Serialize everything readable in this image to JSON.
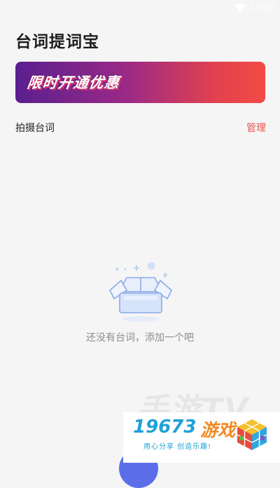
{
  "status_bar": {
    "time": "11:16",
    "wifi_icon": "wifi-icon"
  },
  "app": {
    "title": "台词提词宝"
  },
  "promo": {
    "text": "限时开通优惠",
    "gradient_start": "#5a1f8f",
    "gradient_end": "#f24a45"
  },
  "section": {
    "title": "拍摄台词",
    "manage_label": "管理",
    "accent_color": "#e8574f"
  },
  "empty_state": {
    "icon": "empty-box-icon",
    "message": "还没有台词，添加一个吧"
  },
  "watermark": {
    "text": "手游TV"
  },
  "brand_badge": {
    "number": "19673",
    "name": "游戏",
    "slogan": "用心分享 创造乐趣!",
    "icon": "cube-logo-icon"
  }
}
